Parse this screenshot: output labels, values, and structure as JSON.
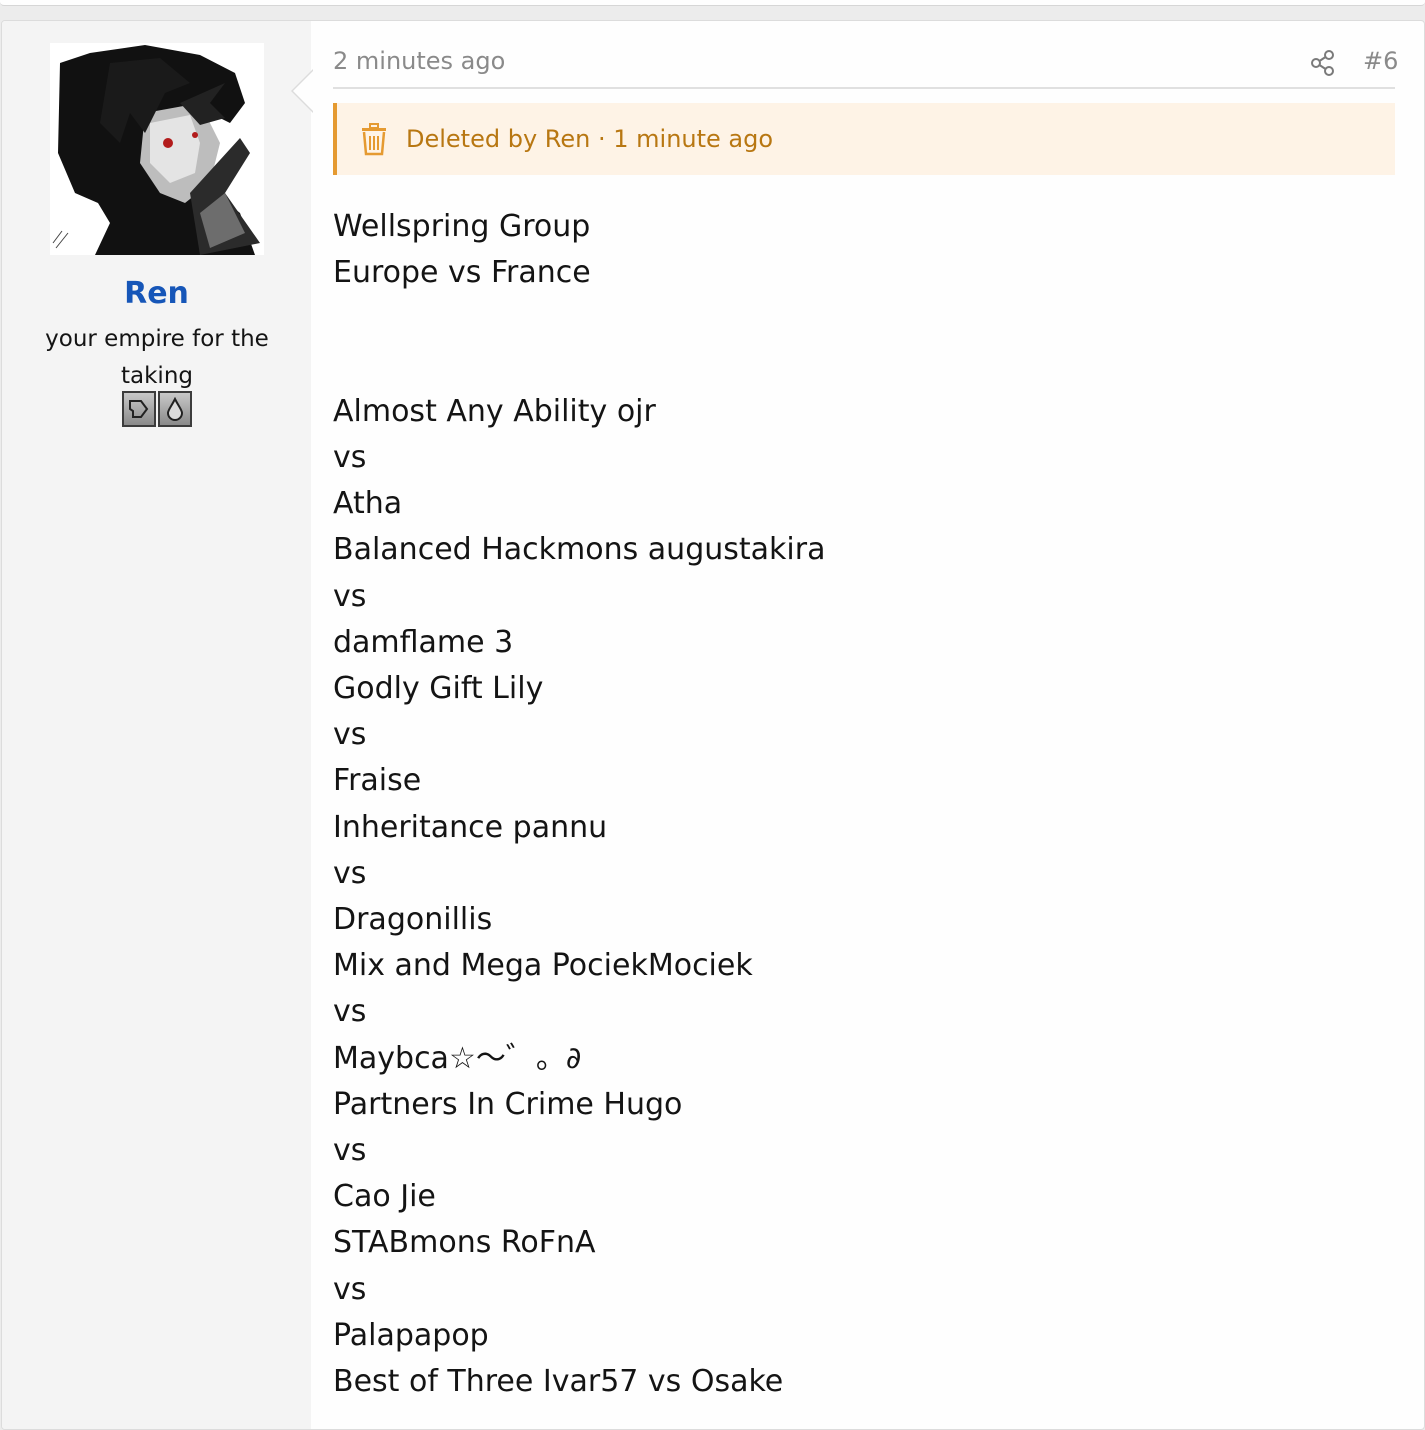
{
  "user": {
    "name": "Ren",
    "title": "your empire for the taking",
    "banners": [
      "badge-icon-1",
      "badge-icon-2"
    ]
  },
  "post": {
    "timestamp": "2 minutes ago",
    "number": "#6",
    "deleted_notice": "Deleted by Ren · 1 minute ago",
    "title_lines": [
      "Wellspring Group",
      "Europe vs France"
    ],
    "body_lines": [
      "Almost Any Ability ojr",
      "vs",
      "Atha",
      "Balanced Hackmons augustakira",
      "vs",
      "damflame 3",
      "Godly Gift Lily",
      "vs",
      "Fraise",
      "Inheritance pannu",
      "vs",
      "Dragonillis",
      "Mix and Mega PociekMociek",
      "vs",
      "Maybca☆～゛。∂",
      "Partners In Crime Hugo",
      "vs",
      "Cao Jie",
      "STABmons RoFnA",
      "vs",
      "Palapapop",
      "Best of Three Ivar57 vs Osake"
    ]
  },
  "colors": {
    "username": "#1656b8",
    "notice_bg": "#fef3e6",
    "notice_border": "#e59a31",
    "notice_text": "#b87712"
  }
}
